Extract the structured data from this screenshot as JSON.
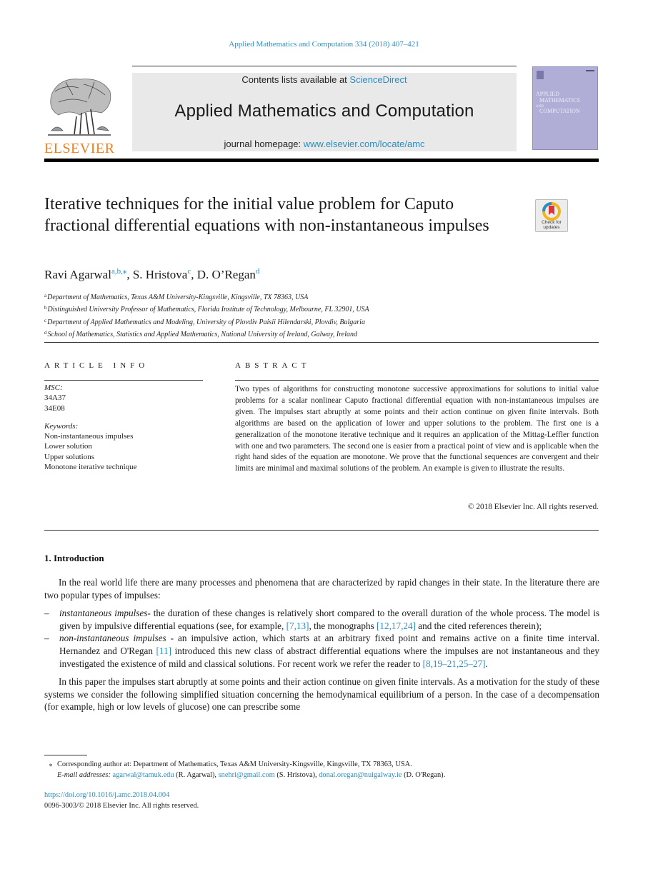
{
  "header": {
    "journal_reference": "Applied Mathematics and Computation 334 (2018) 407–421",
    "publisher_logo_text": "ELSEVIER",
    "contents_prefix": "Contents lists available at ",
    "contents_link": "ScienceDirect",
    "journal_title": "Applied Mathematics and Computation",
    "homepage_prefix": "journal homepage: ",
    "homepage_link": "www.elsevier.com/locate/amc",
    "cover": {
      "line1": "APPLIED",
      "line2": "MATHEMATICS",
      "line3": "AND",
      "line4": "COMPUTATION",
      "color": "#b0aed6"
    },
    "check_updates_label_1": "Check for",
    "check_updates_label_2": "updates"
  },
  "article": {
    "title": "Iterative techniques for the initial value problem for Caputo fractional differential equations with non-instantaneous impulses",
    "authors": [
      {
        "name": "Ravi Agarwal",
        "marks": "a,b,⁎"
      },
      {
        "name": "S. Hristova",
        "marks": "c"
      },
      {
        "name": "D. O’Regan",
        "marks": "d"
      }
    ],
    "affiliations": [
      {
        "mark": "a",
        "text": "Department of Mathematics, Texas A&M University-Kingsville, Kingsville, TX 78363, USA"
      },
      {
        "mark": "b",
        "text": "Distinguished University Professor of Mathematics, Florida Institute of Technology, Melbourne, FL 32901, USA"
      },
      {
        "mark": "c",
        "text": "Department of Applied Mathematics and Modeling, University of Plovdiv Paisii Hilendarski, Plovdiv, Bulgaria"
      },
      {
        "mark": "d",
        "text": "School of Mathematics, Statistics and Applied Mathematics, National University of Ireland, Galway, Ireland"
      }
    ]
  },
  "article_info": {
    "heading": "ARTICLE INFO",
    "msc_label": "MSC:",
    "msc_codes": [
      "34A37",
      "34E08"
    ],
    "keywords_label": "Keywords:",
    "keywords": [
      "Non-instantaneous impulses",
      "Lower solution",
      "Upper solutions",
      "Monotone iterative technique"
    ]
  },
  "abstract": {
    "heading": "ABSTRACT",
    "text": "Two types of algorithms for constructing monotone successive approximations for solutions to initial value problems for a scalar nonlinear Caputo fractional differential equation with non-instantaneous impulses are given. The impulses start abruptly at some points and their action continue on given finite intervals. Both algorithms are based on the application of lower and upper solutions to the problem. The first one is a generalization of the monotone iterative technique and it requires an application of the Mittag-Leffler function with one and two parameters. The second one is easier from a practical point of view and is applicable when the right hand sides of the equation are monotone. We prove that the functional sequences are convergent and their limits are minimal and maximal solutions of the problem. An example is given to illustrate the results.",
    "copyright": "© 2018 Elsevier Inc. All rights reserved."
  },
  "introduction": {
    "heading": "1.  Introduction",
    "para1": "In the real world life there are many processes and phenomena that are characterized by rapid changes in their state. In the literature there are two popular types of impulses:",
    "bullet1": {
      "term": "instantaneous impulses",
      "text_a": "- the duration of these changes is relatively short compared to the overall duration of the whole process. The model is given by impulsive differential equations (see, for example, ",
      "ref1": "[7,13]",
      "text_b": ", the monographs ",
      "ref2": "[12,17,24]",
      "text_c": " and the cited references therein);"
    },
    "bullet2": {
      "term": "non-instantaneous impulses",
      "text_a": " - an impulsive action, which starts at an arbitrary fixed point and remains active on a finite time interval. Hernandez and O'Regan ",
      "ref1": "[11]",
      "text_b": " introduced this new class of abstract differential equations where the impulses are not instantaneous and they investigated the existence of mild and classical solutions. For recent work we refer the reader to ",
      "ref2": "[8,19–21,25–27]",
      "text_c": "."
    },
    "para2": "In this paper the impulses start abruptly at some points and their action continue on given finite intervals. As a motivation for the study of these systems we consider the following simplified situation concerning the hemodynamical equilibrium of a person. In the case of a decompensation (for example, high or low levels of glucose) one can prescribe some"
  },
  "footnotes": {
    "corresponding_mark": "⁎",
    "corresponding": "Corresponding author at: Department of Mathematics, Texas A&M University-Kingsville, Kingsville, TX 78363, USA.",
    "email_label": "E-mail addresses: ",
    "emails": [
      {
        "address": "agarwal@tamuk.edu",
        "owner": " (R. Agarwal), "
      },
      {
        "address": "snehri@gmail.com",
        "owner": " (S. Hristova), "
      },
      {
        "address": "donal.oregan@nuigalway.ie",
        "owner": " (D. O'Regan)."
      }
    ]
  },
  "doi": {
    "link": "https://doi.org/10.1016/j.amc.2018.04.004",
    "issn_line": "0096-3003/© 2018 Elsevier Inc. All rights reserved."
  }
}
